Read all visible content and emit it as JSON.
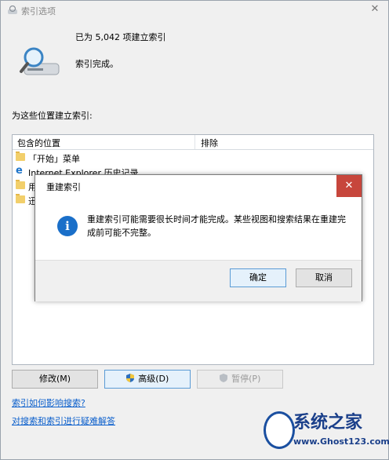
{
  "window": {
    "title": "索引选项",
    "close_glyph": "✕"
  },
  "status": {
    "count_text": "已为 5,042 项建立索引",
    "state_text": "索引完成。"
  },
  "section_label": "为这些位置建立索引:",
  "list": {
    "headers": {
      "included": "包含的位置",
      "excluded": "排除"
    },
    "rows": [
      {
        "label": "「开始」菜单",
        "icon": "folder-icon"
      },
      {
        "label": "Internet Explorer 历史记录",
        "icon": "ie-icon"
      },
      {
        "label": "用",
        "icon": "folder-icon"
      },
      {
        "label": "迅",
        "icon": "folder-icon"
      }
    ]
  },
  "buttons": {
    "modify": "修改(M)",
    "advanced": "高级(D)",
    "pause": "暂停(P)"
  },
  "links": {
    "affect_search": "索引如何影响搜索?",
    "troubleshoot": "对搜索和索引进行疑难解答"
  },
  "dialog": {
    "title": "重建索引",
    "close_glyph": "✕",
    "message": "重建索引可能需要很长时间才能完成。某些视图和搜索结果在重建完成前可能不完整。",
    "ok": "确定",
    "cancel": "取消"
  },
  "watermark": {
    "text": "系统之家",
    "url": "www.Ghost123.com"
  },
  "colors": {
    "accent": "#1a6fc9",
    "close_red": "#c7463c",
    "link": "#0b5fcc"
  }
}
